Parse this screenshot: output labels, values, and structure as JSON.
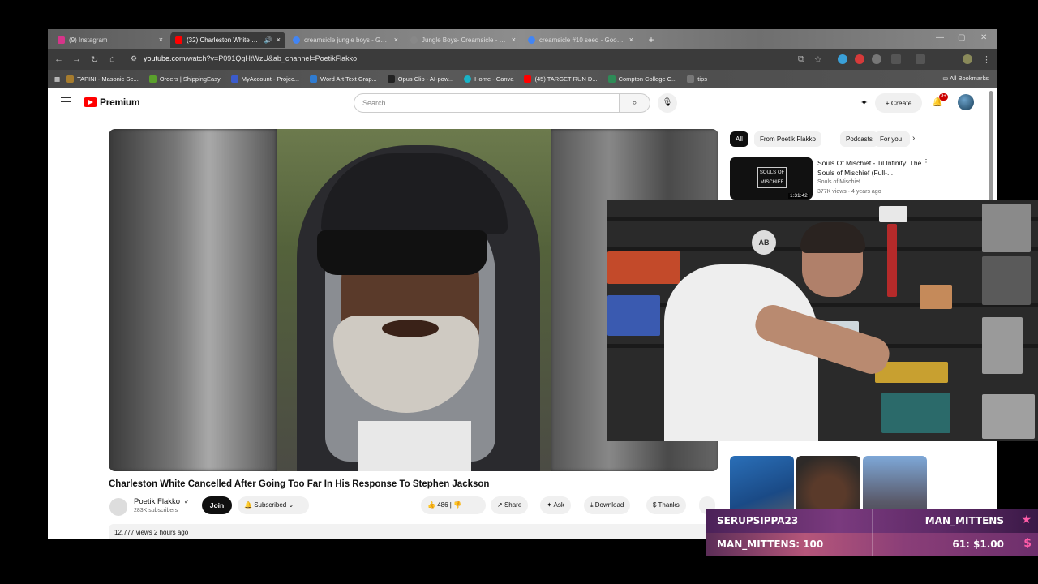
{
  "browser": {
    "tabs": [
      {
        "title": "(9) Instagram",
        "color": "#d6358a",
        "active": false
      },
      {
        "title": "(32) Charleston White Canc",
        "color": "#ff0000",
        "active": true
      },
      {
        "title": "creamsicle jungle boys - Googl",
        "color": "#4285f4",
        "active": false
      },
      {
        "title": "Jungle Boys- Creamsicle - Sup",
        "color": "#888888",
        "active": false
      },
      {
        "title": "creamsicle #10 seed - Google",
        "color": "#4285f4",
        "active": false
      }
    ],
    "tab_close": "×",
    "new_tab": "+",
    "url_prefix": "youtube.com",
    "url_rest": "/watch?v=P091QgHtWzU&ab_channel=PoetikFlakko",
    "bookmarks": [
      {
        "label": "TAPINI - Masonic Se...",
        "color": "#a67c2e"
      },
      {
        "label": "Orders | ShippingEasy",
        "color": "#5aa02c"
      },
      {
        "label": "MyAccount - Projec...",
        "color": "#3b5bcc"
      },
      {
        "label": "Word Art Text Grap...",
        "color": "#2f7bd0"
      },
      {
        "label": "Opus Clip - AI-pow...",
        "color": "#222222"
      },
      {
        "label": "Home - Canva",
        "color": "#19b3c7"
      },
      {
        "label": "(45) TARGET RUN D...",
        "color": "#ff0000"
      },
      {
        "label": "Compton College C...",
        "color": "#2e8b57"
      },
      {
        "label": "tips",
        "color": "#777777"
      }
    ],
    "all_bookmarks": "All Bookmarks"
  },
  "youtube": {
    "logo": "Premium",
    "search_placeholder": "Search",
    "create": "Create",
    "notifications": "9+",
    "video_title": "Charleston White Cancelled After Going Too Far In His Response To Stephen Jackson",
    "channel_name": "Poetik Flakko",
    "subscribers": "283K subscribers",
    "join": "Join",
    "subscribed": "Subscribed",
    "likes": "486",
    "share": "Share",
    "ask": "Ask",
    "download": "Download",
    "thanks": "Thanks",
    "more": "···",
    "views": "12,777 views  2 hours ago",
    "chips": [
      "All",
      "From Poetik Flakko",
      "Podcasts",
      "For you"
    ],
    "recommendation": {
      "title": "Souls Of Mischief - Til Infinity: The Souls of Mischief (Full-...",
      "channel": "Souls of Mischief",
      "meta": "377K views · 4 years ago",
      "duration": "1:31:42",
      "thumb_text": "SOULS OF MISCHIEF"
    }
  },
  "stream": {
    "top_left": "SERUPSIPPA23",
    "top_right": "MAN_MITTENS",
    "bottom_left": "MAN_MITTENS: 100",
    "bottom_right": "61: $1.00",
    "webcam_badge": "AB"
  }
}
